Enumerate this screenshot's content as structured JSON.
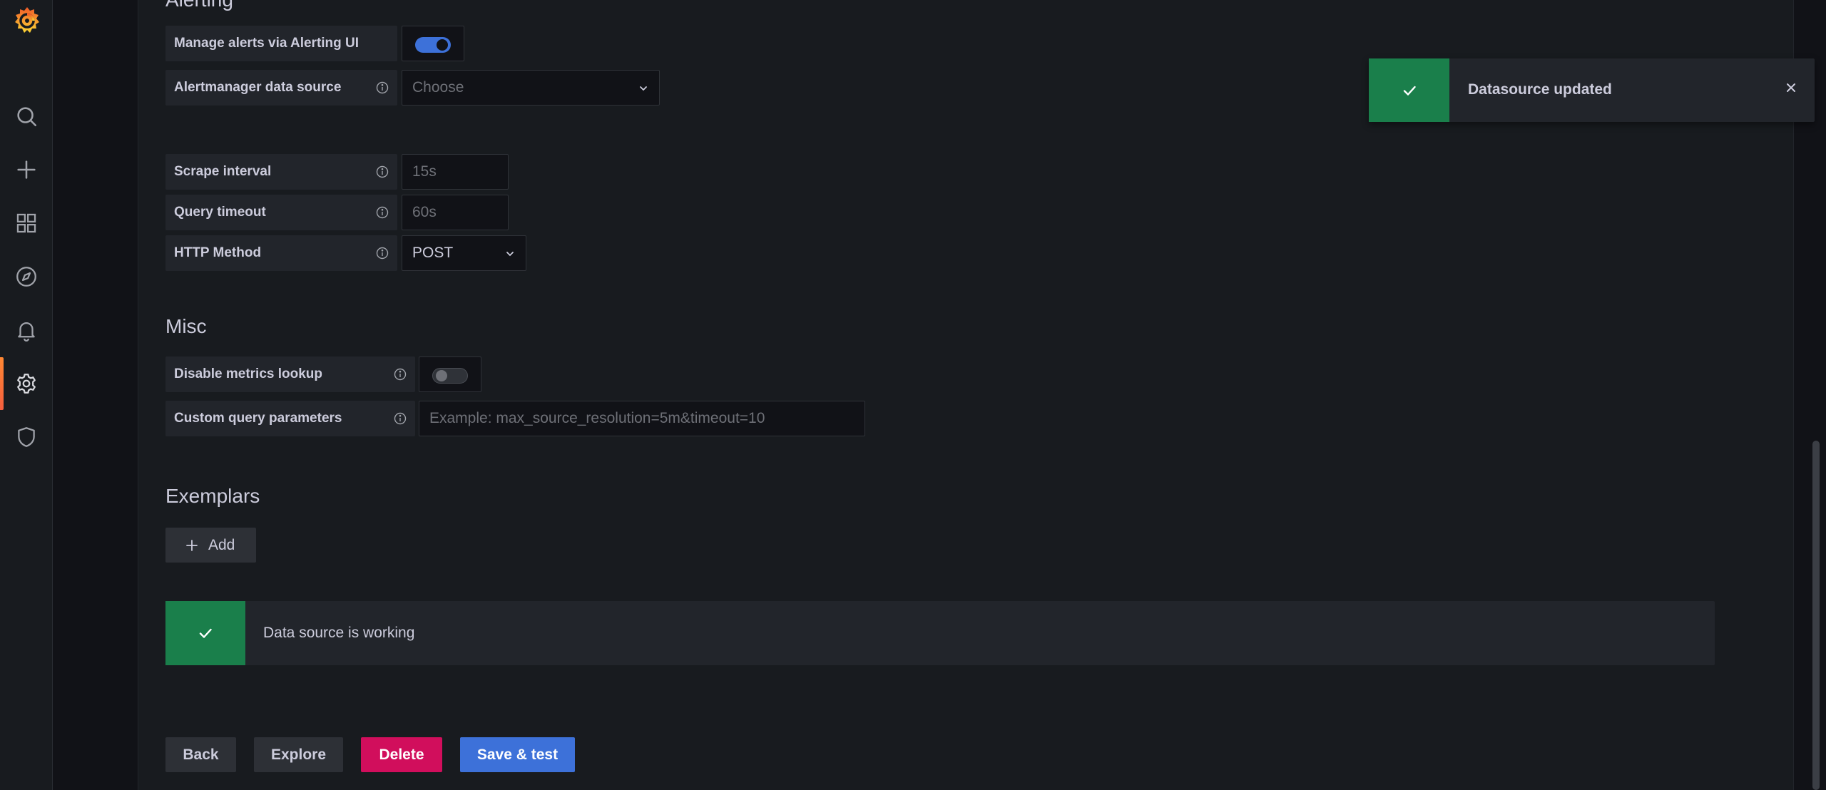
{
  "colors": {
    "background": "#111217",
    "panel": "#181b1f",
    "accent": "#3d71d9",
    "success": "#1a7f4b",
    "danger": "#d10e5c"
  },
  "sidebar": {
    "items": [
      {
        "icon": "search-icon"
      },
      {
        "icon": "plus-icon"
      },
      {
        "icon": "dashboards-icon"
      },
      {
        "icon": "compass-icon"
      },
      {
        "icon": "bell-icon"
      },
      {
        "icon": "gear-icon",
        "active": true
      },
      {
        "icon": "shield-icon"
      }
    ]
  },
  "alerting": {
    "title": "Alerting",
    "manage_alerts_label": "Manage alerts via Alerting UI",
    "manage_alerts_enabled": true,
    "alertmanager_label": "Alertmanager data source",
    "alertmanager_placeholder": "Choose"
  },
  "http": {
    "scrape_interval_label": "Scrape interval",
    "scrape_interval_placeholder": "15s",
    "query_timeout_label": "Query timeout",
    "query_timeout_placeholder": "60s",
    "http_method_label": "HTTP Method",
    "http_method_value": "POST"
  },
  "misc": {
    "title": "Misc",
    "disable_metrics_label": "Disable metrics lookup",
    "disable_metrics_enabled": false,
    "custom_query_label": "Custom query parameters",
    "custom_query_placeholder": "Example: max_source_resolution=5m&timeout=10"
  },
  "exemplars": {
    "title": "Exemplars",
    "add_label": "Add"
  },
  "status_alert": {
    "text": "Data source is working"
  },
  "actions": {
    "back": "Back",
    "explore": "Explore",
    "delete": "Delete",
    "save_test": "Save & test"
  },
  "toast": {
    "text": "Datasource updated"
  }
}
